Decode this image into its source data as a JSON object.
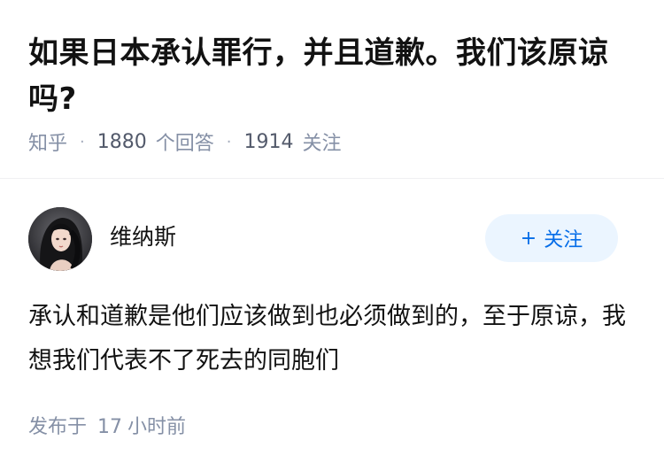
{
  "question": {
    "title": "如果日本承认罪行，并且道歉。我们该原谅吗?",
    "source": "知乎",
    "answer_count": "1880",
    "answer_label": "个回答",
    "follower_count": "1914",
    "follower_label": "关注"
  },
  "answer": {
    "author": {
      "name": "维纳斯",
      "avatar_icon": "portrait-avatar"
    },
    "follow_button": {
      "icon": "plus",
      "label": "关注"
    },
    "content": "承认和道歉是他们应该做到也必须做到的，至于原谅，我想我们代表不了死去的同胞们",
    "time": {
      "prefix": "发布于",
      "value": "17",
      "unit": "小时前"
    }
  },
  "colors": {
    "accent": "#056de8",
    "accent_bg": "#ebf5ff",
    "meta_text": "#8590a6",
    "title_text": "#121212"
  }
}
